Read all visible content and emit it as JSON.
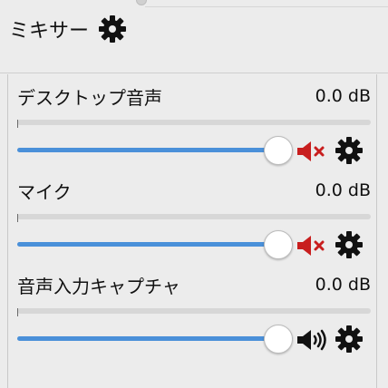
{
  "header": {
    "title": "ミキサー",
    "gear_icon": "gear-icon"
  },
  "channels": [
    {
      "label": "デスクトップ音声",
      "value": "0.0 dB",
      "muted": true,
      "volume_fraction": 1.0
    },
    {
      "label": "マイク",
      "value": "0.0 dB",
      "muted": true,
      "volume_fraction": 1.0
    },
    {
      "label": "音声入力キャプチャ",
      "value": "0.0 dB",
      "muted": false,
      "volume_fraction": 1.0
    }
  ],
  "colors": {
    "slider_fill": "#4a90d9",
    "muted_speaker": "#c81e1e",
    "unmuted_speaker": "#111111",
    "gear": "#111111"
  },
  "icons": {
    "muted": "speaker-muted-icon",
    "unmuted": "speaker-icon",
    "settings": "gear-icon"
  }
}
